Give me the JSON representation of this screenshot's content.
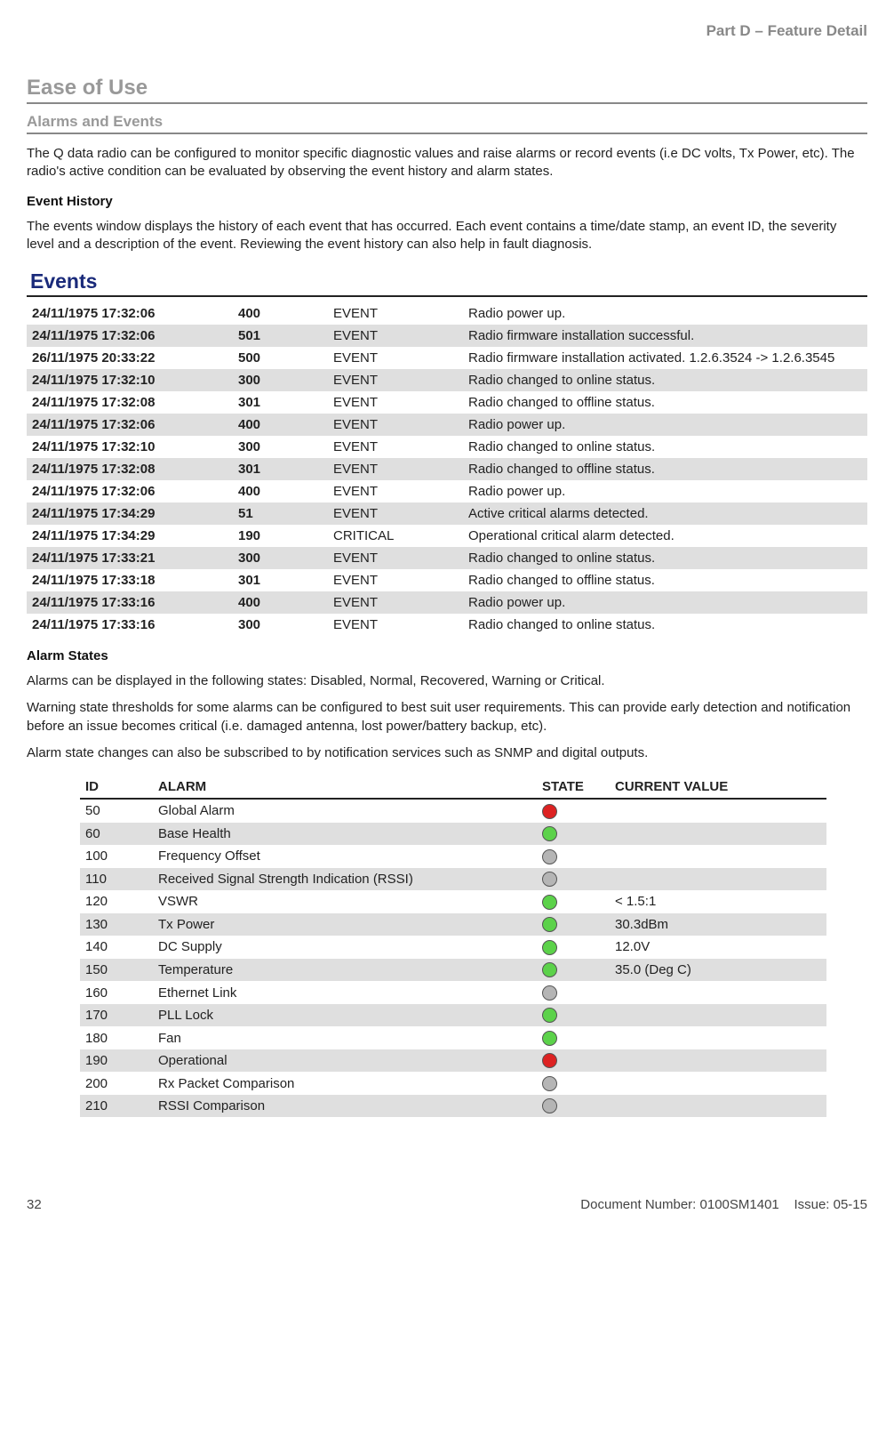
{
  "header": {
    "part_label": "Part D – Feature Detail"
  },
  "section": {
    "title": "Ease of Use",
    "subtitle": "Alarms and Events"
  },
  "intro_p": "The Q data radio can be configured to monitor specific diagnostic values and raise alarms or record events (i.e DC volts, Tx Power, etc). The radio's active condition can be evaluated by observing the event history and alarm states.",
  "event_history": {
    "heading": "Event History",
    "paragraph": "The events window displays the history of each event that has occurred. Each event contains a time/date stamp, an event ID, the severity level and a description of the event. Reviewing the event history can also help in fault diagnosis.",
    "panel_title": "Events",
    "rows": [
      {
        "ts": "24/11/1975 17:32:06",
        "id": "400",
        "sev": "EVENT",
        "desc": "Radio power up."
      },
      {
        "ts": "24/11/1975 17:32:06",
        "id": "501",
        "sev": "EVENT",
        "desc": "Radio firmware installation successful."
      },
      {
        "ts": "26/11/1975 20:33:22",
        "id": "500",
        "sev": "EVENT",
        "desc": "Radio firmware installation activated. 1.2.6.3524 -> 1.2.6.3545"
      },
      {
        "ts": "24/11/1975 17:32:10",
        "id": "300",
        "sev": "EVENT",
        "desc": "Radio changed to online status."
      },
      {
        "ts": "24/11/1975 17:32:08",
        "id": "301",
        "sev": "EVENT",
        "desc": "Radio changed to offline status."
      },
      {
        "ts": "24/11/1975 17:32:06",
        "id": "400",
        "sev": "EVENT",
        "desc": "Radio power up."
      },
      {
        "ts": "24/11/1975 17:32:10",
        "id": "300",
        "sev": "EVENT",
        "desc": "Radio changed to online status."
      },
      {
        "ts": "24/11/1975 17:32:08",
        "id": "301",
        "sev": "EVENT",
        "desc": "Radio changed to offline status."
      },
      {
        "ts": "24/11/1975 17:32:06",
        "id": "400",
        "sev": "EVENT",
        "desc": "Radio power up."
      },
      {
        "ts": "24/11/1975 17:34:29",
        "id": "51",
        "sev": "EVENT",
        "desc": "Active critical alarms detected."
      },
      {
        "ts": "24/11/1975 17:34:29",
        "id": "190",
        "sev": "CRITICAL",
        "desc": "Operational critical alarm detected."
      },
      {
        "ts": "24/11/1975 17:33:21",
        "id": "300",
        "sev": "EVENT",
        "desc": "Radio changed to online status."
      },
      {
        "ts": "24/11/1975 17:33:18",
        "id": "301",
        "sev": "EVENT",
        "desc": "Radio changed to offline status."
      },
      {
        "ts": "24/11/1975 17:33:16",
        "id": "400",
        "sev": "EVENT",
        "desc": "Radio power up."
      },
      {
        "ts": "24/11/1975 17:33:16",
        "id": "300",
        "sev": "EVENT",
        "desc": "Radio changed to online status."
      }
    ]
  },
  "alarm_states": {
    "heading": "Alarm States",
    "p1": "Alarms can be displayed in the following states: Disabled, Normal, Recovered, Warning or Critical.",
    "p2": "Warning state thresholds for some alarms can be configured to best suit user requirements. This can provide early detection and notification before an issue becomes critical (i.e. damaged antenna, lost power/battery backup, etc).",
    "p3": "Alarm state changes can also be subscribed to by notification services such as SNMP and digital outputs.",
    "cols": {
      "id": "ID",
      "alarm": "ALARM",
      "state": "STATE",
      "cur": "CURRENT VALUE"
    },
    "rows": [
      {
        "id": "50",
        "alarm": "Global Alarm",
        "state": "red",
        "val": ""
      },
      {
        "id": "60",
        "alarm": "Base Health",
        "state": "green",
        "val": ""
      },
      {
        "id": "100",
        "alarm": "Frequency Offset",
        "state": "grey",
        "val": ""
      },
      {
        "id": "110",
        "alarm": "Received Signal Strength Indication (RSSI)",
        "state": "grey",
        "val": ""
      },
      {
        "id": "120",
        "alarm": "VSWR",
        "state": "green",
        "val": "< 1.5:1"
      },
      {
        "id": "130",
        "alarm": "Tx Power",
        "state": "green",
        "val": "30.3dBm"
      },
      {
        "id": "140",
        "alarm": "DC Supply",
        "state": "green",
        "val": "12.0V"
      },
      {
        "id": "150",
        "alarm": "Temperature",
        "state": "green",
        "val": "35.0 (Deg C)"
      },
      {
        "id": "160",
        "alarm": "Ethernet Link",
        "state": "grey",
        "val": ""
      },
      {
        "id": "170",
        "alarm": "PLL Lock",
        "state": "green",
        "val": ""
      },
      {
        "id": "180",
        "alarm": "Fan",
        "state": "green",
        "val": ""
      },
      {
        "id": "190",
        "alarm": "Operational",
        "state": "red",
        "val": ""
      },
      {
        "id": "200",
        "alarm": "Rx Packet Comparison",
        "state": "grey",
        "val": ""
      },
      {
        "id": "210",
        "alarm": "RSSI Comparison",
        "state": "grey",
        "val": ""
      }
    ]
  },
  "footer": {
    "page_no": "32",
    "doc": "Document Number: 0100SM1401",
    "issue": "Issue: 05-15"
  }
}
